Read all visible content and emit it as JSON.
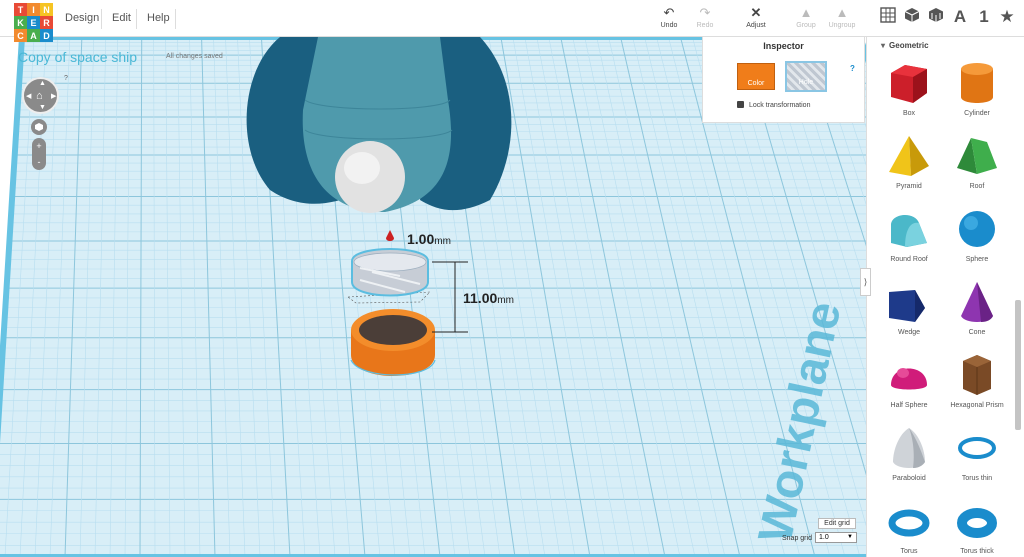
{
  "app": {
    "logo_letters": [
      "T",
      "I",
      "N",
      "K",
      "E",
      "R",
      "C",
      "A",
      "D"
    ],
    "logo_colors": [
      "#e84a36",
      "#f28a2e",
      "#f6c423",
      "#4aae4e",
      "#1a8ccc",
      "#e84a36",
      "#f28a2e",
      "#4aae4e",
      "#1a8ccc"
    ]
  },
  "menu": [
    "Design",
    "Edit",
    "Help"
  ],
  "toolbar": {
    "undo": "Undo",
    "redo": "Redo",
    "adjust": "Adjust",
    "group": "Group",
    "ungroup": "Ungroup"
  },
  "view_modes": [
    "grid-view-icon",
    "cube-view-icon",
    "block-view-icon",
    "text-A-icon",
    "number-1-icon",
    "star-icon"
  ],
  "view_mode_text": {
    "letter": "A",
    "number": "1",
    "star": "★"
  },
  "project": {
    "title": "Copy of space ship",
    "status": "All changes saved"
  },
  "nav": {
    "help": "?",
    "zoom_in": "+",
    "zoom_out": "-"
  },
  "inspector": {
    "title": "Inspector",
    "color_label": "Color",
    "hole_label": "Hole",
    "help": "?",
    "lock_label": "Lock transformation",
    "accent_color": "#f07d1a"
  },
  "dimensions": {
    "height_value": "1.00",
    "height_unit": "mm",
    "elevation_value": "11.00",
    "elevation_unit": "mm"
  },
  "workplane_label": "Workplane",
  "panel": {
    "category": "Geometric",
    "shapes": [
      {
        "label": "Box",
        "icon": "box-icon"
      },
      {
        "label": "Cylinder",
        "icon": "cylinder-icon"
      },
      {
        "label": "Pyramid",
        "icon": "pyramid-icon"
      },
      {
        "label": "Roof",
        "icon": "roof-icon"
      },
      {
        "label": "Round Roof",
        "icon": "round-roof-icon"
      },
      {
        "label": "Sphere",
        "icon": "sphere-icon"
      },
      {
        "label": "Wedge",
        "icon": "wedge-icon"
      },
      {
        "label": "Cone",
        "icon": "cone-icon"
      },
      {
        "label": "Half Sphere",
        "icon": "half-sphere-icon"
      },
      {
        "label": "Hexagonal Prism",
        "icon": "hexagonal-prism-icon"
      },
      {
        "label": "Paraboloid",
        "icon": "paraboloid-icon"
      },
      {
        "label": "Torus thin",
        "icon": "torus-thin-icon"
      },
      {
        "label": "Torus",
        "icon": "torus-icon"
      },
      {
        "label": "Torus thick",
        "icon": "torus-thick-icon"
      }
    ],
    "toggle": "⟩"
  },
  "grid": {
    "edit_label": "Edit grid",
    "snap_label": "Snap grid",
    "snap_value": "1.0"
  }
}
